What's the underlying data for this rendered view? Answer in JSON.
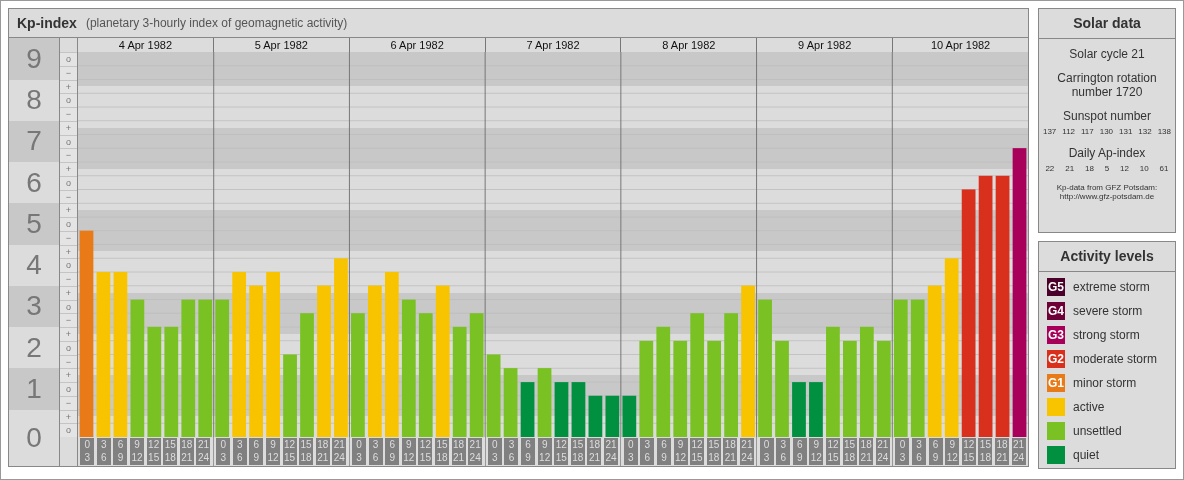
{
  "header": {
    "title": "Kp-index",
    "subtitle": "(planetary 3-hourly index of geomagnetic activity)"
  },
  "kp_chart": {
    "days": [
      "4 Apr 1982",
      "5 Apr 1982",
      "6 Apr 1982",
      "7 Apr 1982",
      "8 Apr 1982",
      "9 Apr 1982",
      "10 Apr 1982"
    ],
    "y_sublabels": [
      "o",
      "−",
      "+",
      "o",
      "−",
      "+",
      "o",
      "−",
      "+",
      "o",
      "−",
      "+",
      "o",
      "−",
      "+",
      "o",
      "−",
      "+",
      "o",
      "−",
      "+",
      "o",
      "−",
      "+",
      "o",
      "−",
      "+",
      "o"
    ],
    "chart_data": {
      "type": "bar",
      "ylim": [
        0,
        9.33
      ],
      "grid": true,
      "yticks": [
        {
          "value": 9,
          "label": "9"
        },
        {
          "value": 8,
          "label": "8"
        },
        {
          "value": 7,
          "label": "7"
        },
        {
          "value": 6,
          "label": "6"
        },
        {
          "value": 5,
          "label": "5"
        },
        {
          "value": 4,
          "label": "4"
        },
        {
          "value": 3,
          "label": "3"
        },
        {
          "value": 2,
          "label": "2"
        },
        {
          "value": 1,
          "label": "1"
        },
        {
          "value": 0,
          "label": "0"
        }
      ],
      "categories": [
        "0 3",
        "3 6",
        "6 9",
        "9 12",
        "12 15",
        "15 18",
        "18 21",
        "21 24",
        "0 3",
        "3 6",
        "6 9",
        "9 12",
        "12 15",
        "15 18",
        "18 21",
        "21 24",
        "0 3",
        "3 6",
        "6 9",
        "9 12",
        "12 15",
        "15 18",
        "18 21",
        "21 24",
        "0 3",
        "3 6",
        "6 9",
        "9 12",
        "12 15",
        "15 18",
        "18 21",
        "21 24",
        "0 3",
        "3 6",
        "6 9",
        "9 12",
        "12 15",
        "15 18",
        "18 21",
        "21 24",
        "0 3",
        "3 6",
        "6 9",
        "9 12",
        "12 15",
        "15 18",
        "18 21",
        "21 24",
        "0 3",
        "3 6",
        "6 9",
        "9 12",
        "12 15",
        "15 18",
        "18 21",
        "21 24"
      ],
      "series": [
        {
          "name": "extreme storm",
          "color": "#4a0028",
          "values": [
            null,
            null,
            null,
            null,
            null,
            null,
            null,
            null,
            null,
            null,
            null,
            null,
            null,
            null,
            null,
            null,
            null,
            null,
            null,
            null,
            null,
            null,
            null,
            null,
            null,
            null,
            null,
            null,
            null,
            null,
            null,
            null,
            null,
            null,
            null,
            null,
            null,
            null,
            null,
            null,
            null,
            null,
            null,
            null,
            null,
            null,
            null,
            null,
            null,
            null,
            null,
            null,
            null,
            null,
            null,
            null
          ]
        },
        {
          "name": "severe storm",
          "color": "#6e0038",
          "values": [
            null,
            null,
            null,
            null,
            null,
            null,
            null,
            null,
            null,
            null,
            null,
            null,
            null,
            null,
            null,
            null,
            null,
            null,
            null,
            null,
            null,
            null,
            null,
            null,
            null,
            null,
            null,
            null,
            null,
            null,
            null,
            null,
            null,
            null,
            null,
            null,
            null,
            null,
            null,
            null,
            null,
            null,
            null,
            null,
            null,
            null,
            null,
            null,
            null,
            null,
            null,
            null,
            null,
            null,
            null,
            null
          ]
        },
        {
          "name": "strong storm",
          "color": "#a8005a",
          "values": [
            null,
            null,
            null,
            null,
            null,
            null,
            null,
            null,
            null,
            null,
            null,
            null,
            null,
            null,
            null,
            null,
            null,
            null,
            null,
            null,
            null,
            null,
            null,
            null,
            null,
            null,
            null,
            null,
            null,
            null,
            null,
            null,
            null,
            null,
            null,
            null,
            null,
            null,
            null,
            null,
            null,
            null,
            null,
            null,
            null,
            null,
            null,
            null,
            null,
            null,
            null,
            null,
            null,
            null,
            null,
            7
          ]
        },
        {
          "name": "moderate storm",
          "color": "#d9301e",
          "values": [
            null,
            null,
            null,
            null,
            null,
            null,
            null,
            null,
            null,
            null,
            null,
            null,
            null,
            null,
            null,
            null,
            null,
            null,
            null,
            null,
            null,
            null,
            null,
            null,
            null,
            null,
            null,
            null,
            null,
            null,
            null,
            null,
            null,
            null,
            null,
            null,
            null,
            null,
            null,
            null,
            null,
            null,
            null,
            null,
            null,
            null,
            null,
            null,
            null,
            null,
            null,
            null,
            6,
            6.33,
            6.33,
            null
          ]
        },
        {
          "name": "minor storm",
          "color": "#e87a18",
          "values": [
            5,
            null,
            null,
            null,
            null,
            null,
            null,
            null,
            null,
            null,
            null,
            null,
            null,
            null,
            null,
            null,
            null,
            null,
            null,
            null,
            null,
            null,
            null,
            null,
            null,
            null,
            null,
            null,
            null,
            null,
            null,
            null,
            null,
            null,
            null,
            null,
            null,
            null,
            null,
            null,
            null,
            null,
            null,
            null,
            null,
            null,
            null,
            null,
            null,
            null,
            null,
            null,
            null,
            null,
            null,
            null
          ]
        },
        {
          "name": "active",
          "color": "#f8c400",
          "values": [
            null,
            4,
            4,
            null,
            null,
            null,
            null,
            null,
            null,
            4,
            3.67,
            4,
            null,
            null,
            3.67,
            4.33,
            null,
            3.67,
            4,
            null,
            null,
            3.67,
            null,
            null,
            null,
            null,
            null,
            null,
            null,
            null,
            null,
            null,
            null,
            null,
            null,
            null,
            null,
            null,
            null,
            3.67,
            null,
            null,
            null,
            null,
            null,
            null,
            null,
            null,
            null,
            null,
            3.67,
            4.33,
            null,
            null,
            null,
            null
          ]
        },
        {
          "name": "unsettled",
          "color": "#7ac124",
          "values": [
            null,
            null,
            null,
            3.33,
            2.67,
            2.67,
            3.33,
            3.33,
            3.33,
            null,
            null,
            null,
            2,
            3,
            null,
            null,
            3,
            null,
            null,
            3.33,
            3,
            null,
            2.67,
            3,
            2,
            1.67,
            null,
            1.67,
            null,
            null,
            null,
            null,
            null,
            2.33,
            2.67,
            2.33,
            3,
            2.33,
            3,
            null,
            3.33,
            2.33,
            null,
            null,
            2.67,
            2.33,
            2.67,
            2.33,
            3.33,
            3.33,
            null,
            null,
            null,
            null,
            null,
            null
          ]
        },
        {
          "name": "quiet",
          "color": "#009040",
          "values": [
            null,
            null,
            null,
            null,
            null,
            null,
            null,
            null,
            null,
            null,
            null,
            null,
            null,
            null,
            null,
            null,
            null,
            null,
            null,
            null,
            null,
            null,
            null,
            null,
            null,
            null,
            1.33,
            null,
            1.33,
            1.33,
            1,
            1,
            1,
            null,
            null,
            null,
            null,
            null,
            null,
            null,
            null,
            null,
            1.33,
            1.33,
            null,
            null,
            null,
            null,
            null,
            null,
            null,
            null,
            null,
            null,
            null,
            null
          ]
        }
      ]
    }
  },
  "solar_data": {
    "title": "Solar data",
    "cycle": "Solar cycle 21",
    "rotation": "Carrington rotation number 1720",
    "sunspot_title": "Sunspot number",
    "sunspot_numbers": [
      "137",
      "112",
      "117",
      "130",
      "131",
      "132",
      "138"
    ],
    "ap_title": "Daily Ap-index",
    "ap_values": [
      "22",
      "21",
      "18",
      "5",
      "12",
      "10",
      "61"
    ],
    "source": "Kp-data from GFZ Potsdam:",
    "source_url": "http://www.gfz-potsdam.de"
  },
  "activity_levels": {
    "title": "Activity levels",
    "codes": [
      "G5",
      "G4",
      "G3",
      "G2",
      "G1"
    ]
  }
}
